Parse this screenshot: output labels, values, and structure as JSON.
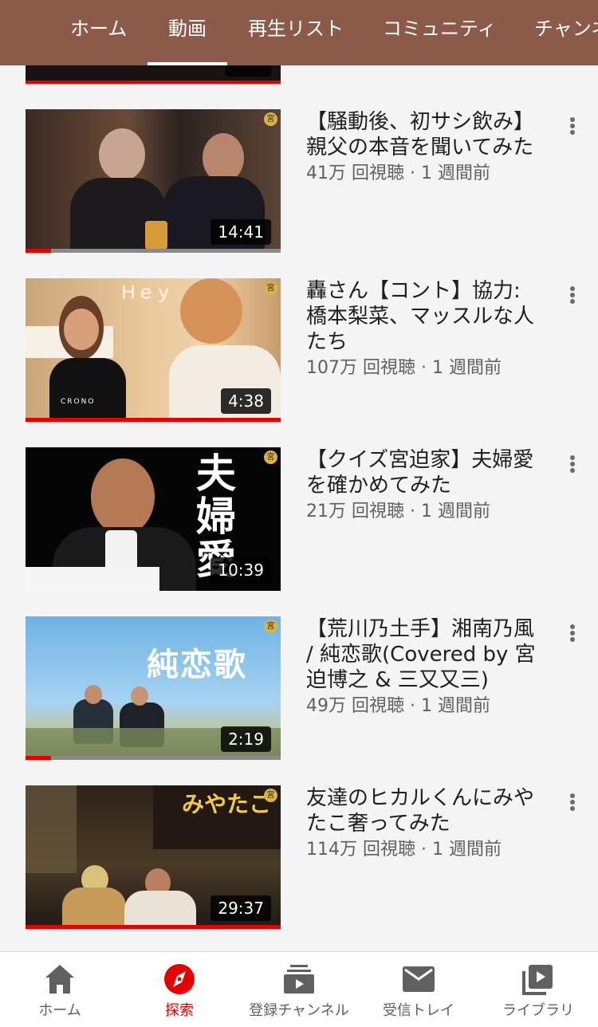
{
  "tabs": [
    {
      "label": "ホーム"
    },
    {
      "label": "動画",
      "active": true
    },
    {
      "label": "再生リスト"
    },
    {
      "label": "コミュニティ"
    },
    {
      "label": "チャンネル"
    }
  ],
  "videos": [
    {
      "title": "【騒動後、初サシ飲み】親父の本音を聞いてみた",
      "meta": "41万 回視聴 · 1 週間前",
      "duration": "14:41",
      "watched_fraction": 0.1,
      "channel_mark": "宮"
    },
    {
      "title": "轟さん【コント】協力: 橋本梨菜、マッスルな人たち",
      "meta": "107万 回視聴 · 1 週間前",
      "duration": "4:38",
      "watched_fraction": 1.0,
      "channel_mark": "宮",
      "overlay_text": "CRONO"
    },
    {
      "title": "【クイズ宮迫家】夫婦愛を確かめてみた",
      "meta": "21万 回視聴 · 1 週間前",
      "duration": "10:39",
      "watched_fraction": 0,
      "channel_mark": "宮",
      "overlay_text": "夫婦愛"
    },
    {
      "title": "【荒川乃土手】湘南乃風 / 純恋歌(Covered by 宮迫博之 & 三又又三)",
      "meta": "49万 回視聴 · 1 週間前",
      "duration": "2:19",
      "watched_fraction": 0.1,
      "channel_mark": "宮",
      "overlay_text": "純恋歌"
    },
    {
      "title": "友達のヒカルくんにみやたこ奢ってみた",
      "meta": "114万 回視聴 · 1 週間前",
      "duration": "29:37",
      "watched_fraction": 1.0,
      "channel_mark": "宮",
      "overlay_text": "みやたこ"
    }
  ],
  "bottom_nav": [
    {
      "label": "ホーム",
      "icon": "home-icon"
    },
    {
      "label": "探索",
      "icon": "explore-icon",
      "active": true
    },
    {
      "label": "登録チャンネル",
      "icon": "subscriptions-icon"
    },
    {
      "label": "受信トレイ",
      "icon": "inbox-icon"
    },
    {
      "label": "ライブラリ",
      "icon": "library-icon"
    }
  ],
  "colors": {
    "topbar": "#8b5a48",
    "accent_red": "#e60000",
    "background": "#f4f4f4"
  }
}
